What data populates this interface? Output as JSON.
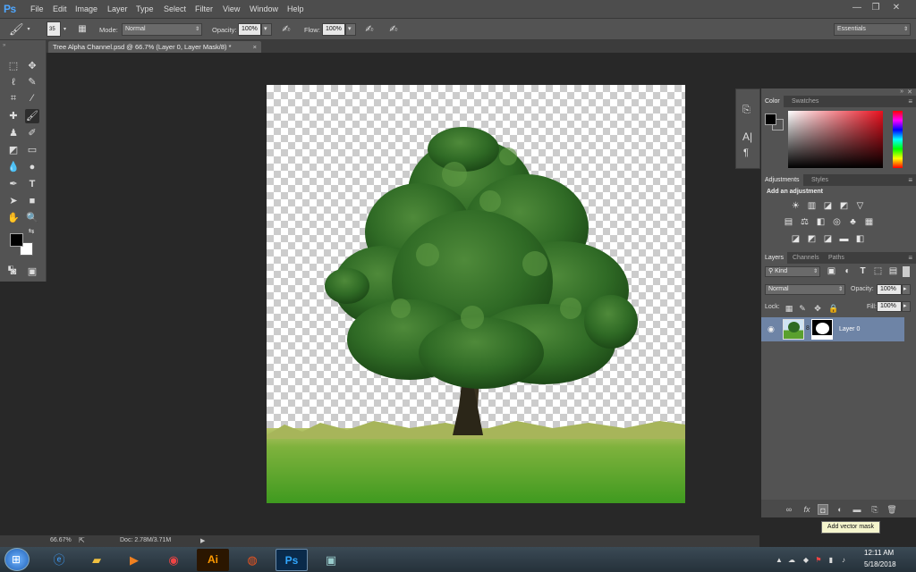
{
  "app": {
    "logo": "Ps"
  },
  "menu": [
    "File",
    "Edit",
    "Image",
    "Layer",
    "Type",
    "Select",
    "Filter",
    "View",
    "Window",
    "Help"
  ],
  "window_controls": {
    "minimize": "—",
    "restore": "❐",
    "close": "✕"
  },
  "options_bar": {
    "brush_size": "35",
    "mode_label": "Mode:",
    "mode_value": "Normal",
    "opacity_label": "Opacity:",
    "opacity_value": "100%",
    "flow_label": "Flow:",
    "flow_value": "100%",
    "workspace": "Essentials"
  },
  "document": {
    "tab_title": "Tree Alpha Channel.psd @ 66.7% (Layer 0, Layer Mask/8) *",
    "tab_close": "×"
  },
  "panels": {
    "color_tabs": [
      "Color",
      "Swatches"
    ],
    "adjustments_tabs": [
      "Adjustments",
      "Styles"
    ],
    "adjustments_heading": "Add an adjustment",
    "layers_tabs": [
      "Layers",
      "Channels",
      "Paths"
    ],
    "kind_label": "Kind",
    "blend_mode": "Normal",
    "opacity_label": "Opacity:",
    "opacity_value": "100%",
    "lock_label": "Lock:",
    "fill_label": "Fill:",
    "fill_value": "100%",
    "layer_name": "Layer 0"
  },
  "tooltip": "Add vector mask",
  "status": {
    "zoom": "66.67%",
    "doc": "Doc: 2.78M/3.71M"
  },
  "taskbar": {
    "time": "12:11 AM",
    "date": "5/18/2018",
    "apps": [
      "Internet Explorer",
      "File Explorer",
      "Media Player",
      "Chrome",
      "Illustrator",
      "Ubuntu",
      "Photoshop",
      "Image Viewer"
    ],
    "ai_label": "Ai",
    "ps_label": "Ps"
  },
  "colors": {
    "accent": "#4fa7ff",
    "panel": "#535353",
    "dark": "#282828",
    "layer_selected": "#6e84a6"
  }
}
